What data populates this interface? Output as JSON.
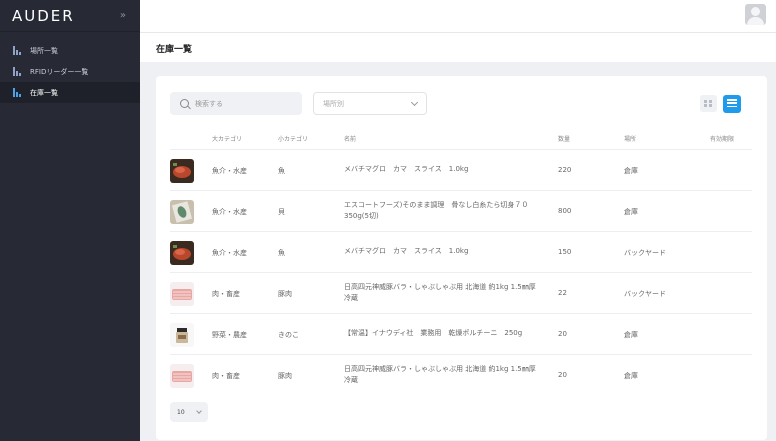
{
  "app": {
    "logo": "AUDER",
    "collapse_icon": "»"
  },
  "sidebar": {
    "items": [
      {
        "label": "場所一覧",
        "icon": "chart-icon",
        "active": false
      },
      {
        "label": "RFIDリーダー一覧",
        "icon": "chart-icon",
        "active": false
      },
      {
        "label": "在庫一覧",
        "icon": "chart-icon",
        "active": true
      }
    ]
  },
  "header": {
    "avatar": "user-avatar-icon"
  },
  "page": {
    "title": "在庫一覧"
  },
  "toolbar": {
    "search_placeholder": "検索する",
    "location_placeholder": "場所別",
    "view_grid_icon": "grid-view-icon",
    "view_list_icon": "list-view-icon"
  },
  "table": {
    "columns": [
      "大カテゴリ",
      "小カテゴリ",
      "名前",
      "数量",
      "場所",
      "有効期限"
    ],
    "rows": [
      {
        "thumb": "tuna",
        "large": "魚介・水産",
        "small": "魚",
        "name": "メバチマグロ　カマ　スライス　1.0kg",
        "qty": "220",
        "place": "倉庫",
        "expiry": ""
      },
      {
        "thumb": "fish-pack",
        "large": "魚介・水産",
        "small": "貝",
        "name": "エスコートフーズ)そのまま調理　骨なし白糸たら切身７０350g(5切)",
        "qty": "800",
        "place": "倉庫",
        "expiry": ""
      },
      {
        "thumb": "tuna",
        "large": "魚介・水産",
        "small": "魚",
        "name": "メバチマグロ　カマ　スライス　1.0kg",
        "qty": "150",
        "place": "バックヤード",
        "expiry": ""
      },
      {
        "thumb": "pork",
        "large": "肉・畜産",
        "small": "豚肉",
        "name": "日高四元神威豚バラ・しゃぶしゃぶ用 北海道 約1kg 1.5㎜厚 冷蔵",
        "qty": "22",
        "place": "バックヤード",
        "expiry": ""
      },
      {
        "thumb": "jar",
        "large": "野菜・農産",
        "small": "きのこ",
        "name": "【常温】イナウディ社　業務用　乾燥ポルチーニ　250g",
        "qty": "20",
        "place": "倉庫",
        "expiry": ""
      },
      {
        "thumb": "pork",
        "large": "肉・畜産",
        "small": "豚肉",
        "name": "日高四元神威豚バラ・しゃぶしゃぶ用 北海道 約1kg 1.5㎜厚 冷蔵",
        "qty": "20",
        "place": "倉庫",
        "expiry": ""
      }
    ]
  },
  "pagination": {
    "page_size": "10"
  }
}
